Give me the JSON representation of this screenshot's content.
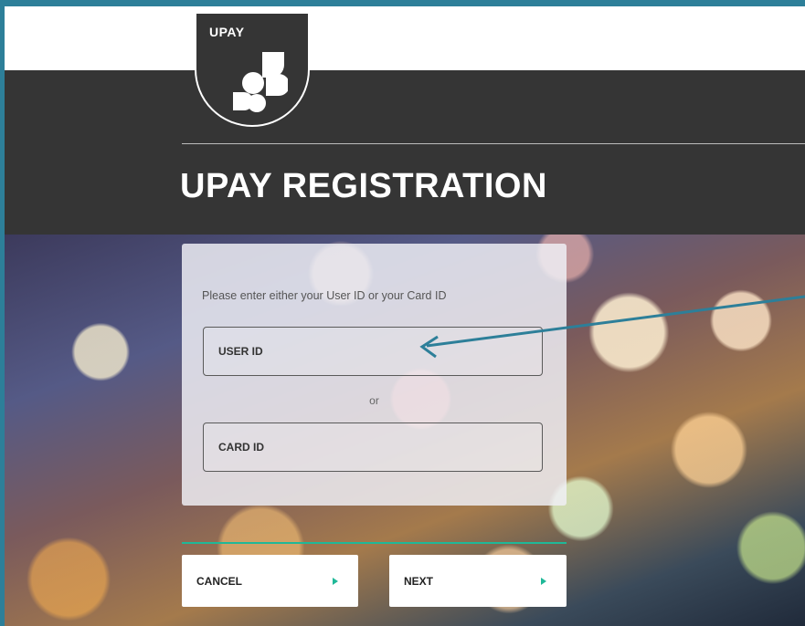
{
  "brand": {
    "logo_text": "UPAY",
    "logo_icon": "upay-logo-icon"
  },
  "page": {
    "title": "UPAY REGISTRATION"
  },
  "form": {
    "instruction": "Please enter either your User ID or your Card ID",
    "user_id_label": "USER ID",
    "separator": "or",
    "card_id_label": "CARD ID"
  },
  "actions": {
    "cancel_label": "CANCEL",
    "next_label": "NEXT",
    "arrow_icon": "triangle-right-icon"
  },
  "colors": {
    "frame_border": "#2d7f99",
    "header_band": "#353535",
    "accent": "#1fb898",
    "annotation_arrow": "#2d7f99"
  }
}
